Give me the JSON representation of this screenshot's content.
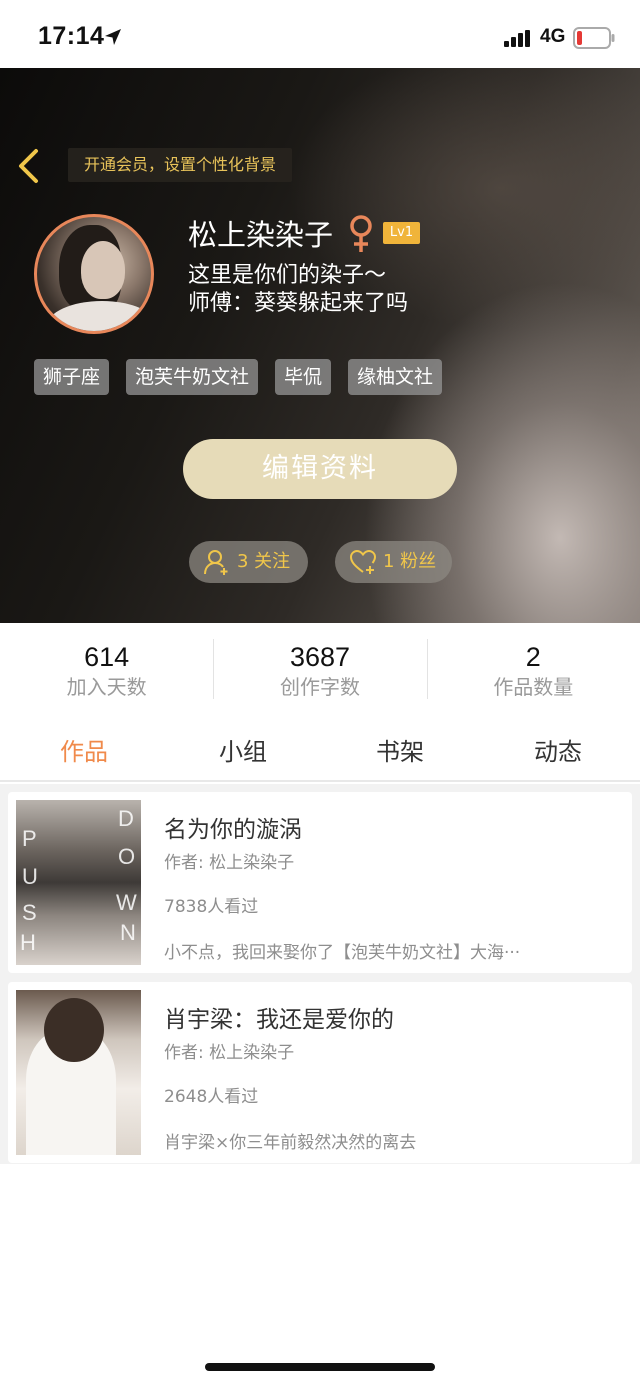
{
  "status_bar": {
    "time": "17:14",
    "network": "4G",
    "icons": [
      "location-arrow-icon",
      "signal-bars-icon",
      "battery-low-icon"
    ]
  },
  "header": {
    "back_icon": "chevron-left-icon",
    "vip_banner": "开通会员，设置个性化背景",
    "nickname": "松上染染子",
    "gender_icon": "female-icon",
    "level": "Lv1",
    "bio_line1": "这里是你们的染子～",
    "bio_line2": "师傅：葵葵躲起来了吗",
    "tags": [
      "狮子座",
      "泡芙牛奶文社",
      "毕侃",
      "缘柚文社"
    ],
    "edit_button": "编辑资料",
    "following_label": "3 关注",
    "fans_label": "1 粉丝",
    "colors": {
      "accent_gold": "#f0c64a",
      "level_badge": "#f0b43a",
      "avatar_ring": "#e8875a",
      "edit_button_bg": "#e6dbb8"
    }
  },
  "stats": [
    {
      "value": "614",
      "label": "加入天数"
    },
    {
      "value": "3687",
      "label": "创作字数"
    },
    {
      "value": "2",
      "label": "作品数量"
    }
  ],
  "tabs": [
    {
      "label": "作品",
      "active": true
    },
    {
      "label": "小组",
      "active": false
    },
    {
      "label": "书架",
      "active": false
    },
    {
      "label": "动态",
      "active": false
    }
  ],
  "works": [
    {
      "title": "名为你的漩涡",
      "author": "作者: 松上染染子",
      "views": "7838人看过",
      "description": "小不点，我回来娶你了【泡芙牛奶文社】大海···",
      "cover_letters": [
        "P",
        "D",
        "U",
        "O",
        "S",
        "W",
        "H",
        "N"
      ]
    },
    {
      "title": "肖宇梁：我还是爱你的",
      "author": "作者: 松上染染子",
      "views": "2648人看过",
      "description": "肖宇梁×你三年前毅然决然的离去"
    }
  ],
  "tab_accent_color": "#f08a4b"
}
